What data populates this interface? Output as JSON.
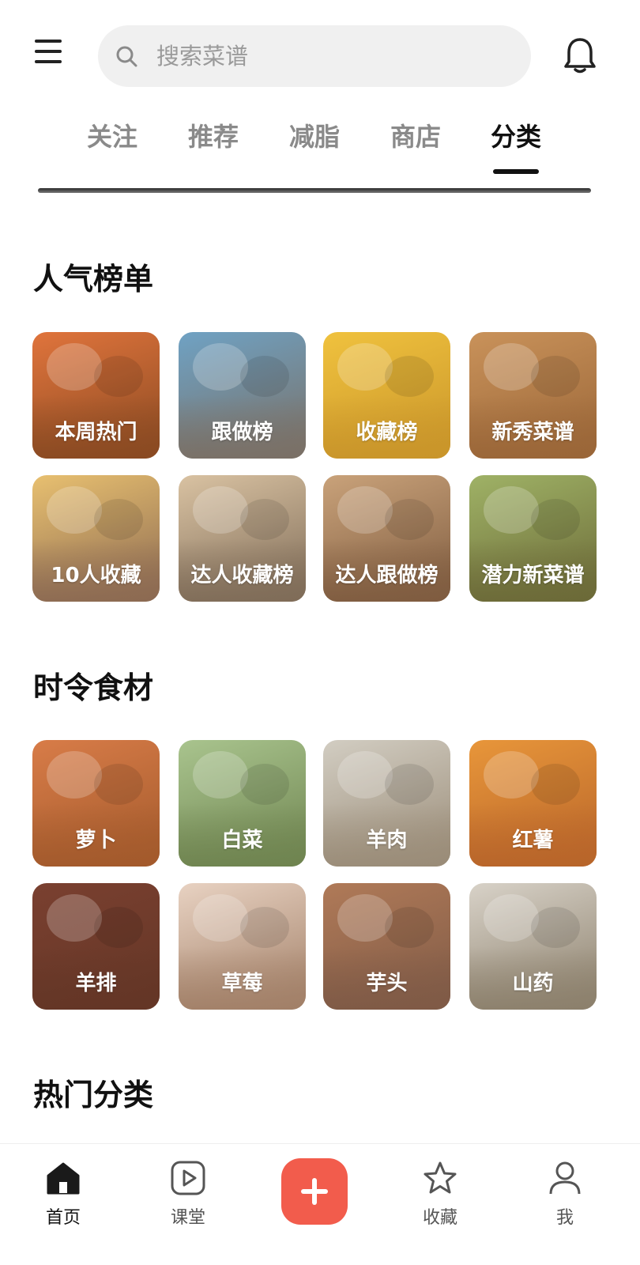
{
  "search": {
    "placeholder": "搜索菜谱"
  },
  "tabs": [
    {
      "label": "关注"
    },
    {
      "label": "推荐"
    },
    {
      "label": "减脂"
    },
    {
      "label": "商店"
    },
    {
      "label": "分类",
      "active": true
    }
  ],
  "popular": {
    "title": "人气榜单",
    "items": [
      {
        "label": "本周热门",
        "colors": [
          "#e0743c",
          "#8a4a22"
        ]
      },
      {
        "label": "跟做榜",
        "colors": [
          "#6fa2c4",
          "#7a7066"
        ]
      },
      {
        "label": "收藏榜",
        "colors": [
          "#f0c23e",
          "#c9952a"
        ]
      },
      {
        "label": "新秀菜谱",
        "colors": [
          "#c9925a",
          "#9a6638"
        ]
      },
      {
        "label": "10人收藏",
        "colors": [
          "#e8c070",
          "#8c6a52"
        ]
      },
      {
        "label": "达人收藏榜",
        "colors": [
          "#d9c2a2",
          "#7f6c58"
        ]
      },
      {
        "label": "达人跟做榜",
        "colors": [
          "#c9a27a",
          "#7f5c40"
        ]
      },
      {
        "label": "潜力新菜谱",
        "colors": [
          "#9fb266",
          "#6c6a38"
        ]
      }
    ]
  },
  "seasonal": {
    "title": "时令食材",
    "items": [
      {
        "label": "萝卜",
        "colors": [
          "#d87c48",
          "#a35a2c"
        ]
      },
      {
        "label": "白菜",
        "colors": [
          "#a9c48e",
          "#6f8450"
        ]
      },
      {
        "label": "羊肉",
        "colors": [
          "#d2cdc2",
          "#9a8c78"
        ]
      },
      {
        "label": "红薯",
        "colors": [
          "#e8963a",
          "#b8652a"
        ]
      },
      {
        "label": "羊排",
        "colors": [
          "#7a4030",
          "#643626"
        ]
      },
      {
        "label": "草莓",
        "colors": [
          "#e8d2c2",
          "#a28068"
        ]
      },
      {
        "label": "芋头",
        "colors": [
          "#b07a58",
          "#7f5a46"
        ]
      },
      {
        "label": "山药",
        "colors": [
          "#d8d2c8",
          "#8c806c"
        ]
      }
    ]
  },
  "hot_categories": {
    "title": "热门分类"
  },
  "bottom_nav": {
    "home": "首页",
    "classroom": "课堂",
    "favorites": "收藏",
    "me": "我"
  },
  "colors": {
    "accent": "#f25c4c",
    "text": "#111111",
    "muted": "#8a8a8a"
  }
}
